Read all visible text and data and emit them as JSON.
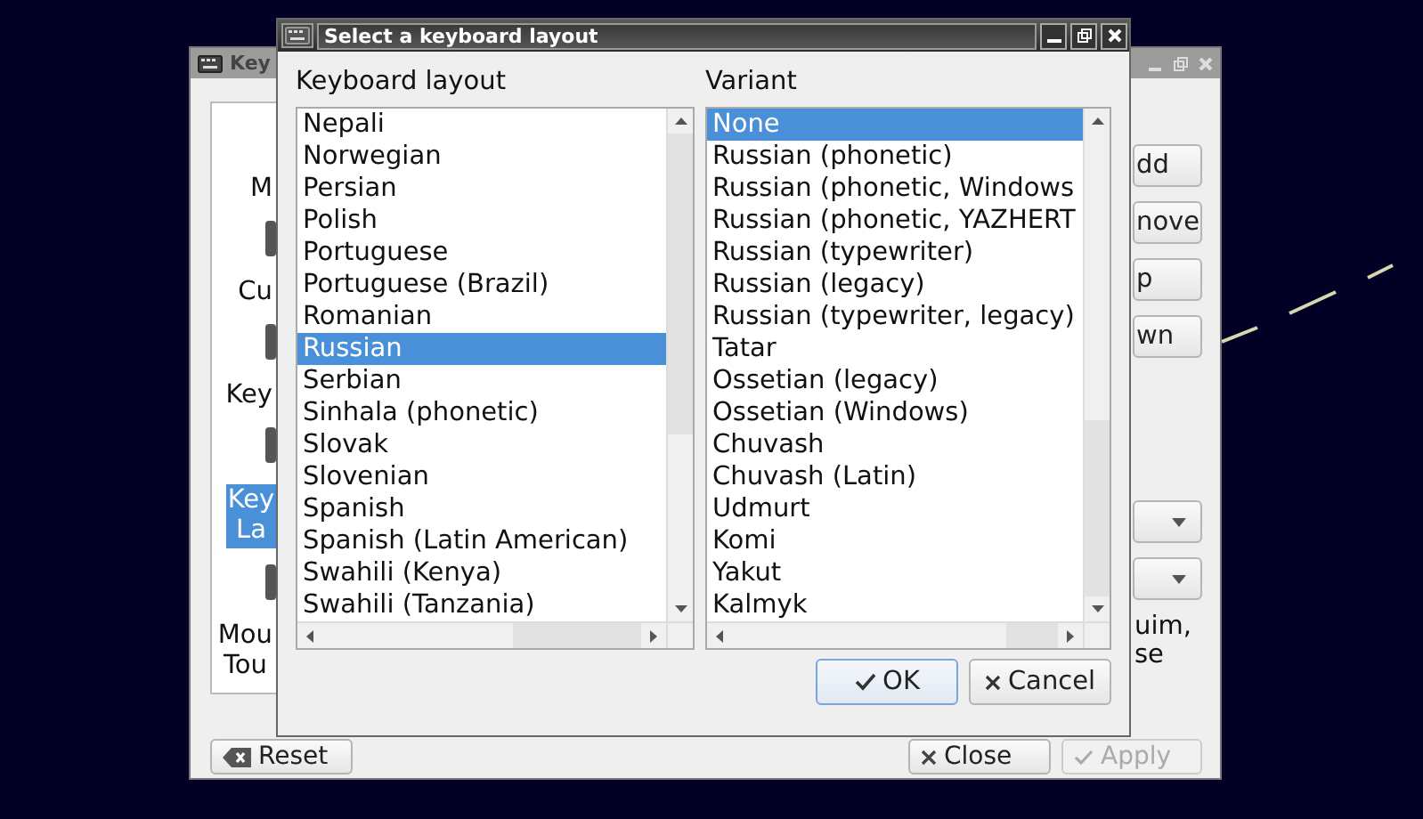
{
  "background_window": {
    "title": "Key",
    "sidebar": [
      {
        "kind": "label",
        "lines": [
          "M"
        ],
        "selected": false
      },
      {
        "kind": "icon_label",
        "lines": [
          "Cu"
        ],
        "selected": false
      },
      {
        "kind": "icon_label",
        "lines": [
          "Key"
        ],
        "selected": false
      },
      {
        "kind": "icon_label",
        "lines": [
          "Key",
          "La"
        ],
        "selected": true
      },
      {
        "kind": "icon_label",
        "lines": [
          "Mou",
          "Tou"
        ],
        "selected": false
      }
    ],
    "side_buttons": [
      "dd",
      "nove",
      "p",
      "wn"
    ],
    "note_lines": [
      "uim,",
      "se"
    ],
    "footer_buttons": [
      {
        "kind": "reset",
        "label": "Reset",
        "disabled": false
      },
      {
        "kind": "close",
        "label": "Close",
        "disabled": false
      },
      {
        "kind": "apply",
        "label": "Apply",
        "disabled": true
      }
    ]
  },
  "dialog": {
    "title": "Select a keyboard layout",
    "layout_label": "Keyboard layout",
    "layouts": [
      {
        "label": "Nepali",
        "selected": false
      },
      {
        "label": "Norwegian",
        "selected": false
      },
      {
        "label": "Persian",
        "selected": false
      },
      {
        "label": "Polish",
        "selected": false
      },
      {
        "label": "Portuguese",
        "selected": false
      },
      {
        "label": "Portuguese (Brazil)",
        "selected": false
      },
      {
        "label": "Romanian",
        "selected": false
      },
      {
        "label": "Russian",
        "selected": true
      },
      {
        "label": "Serbian",
        "selected": false
      },
      {
        "label": "Sinhala (phonetic)",
        "selected": false
      },
      {
        "label": "Slovak",
        "selected": false
      },
      {
        "label": "Slovenian",
        "selected": false
      },
      {
        "label": "Spanish",
        "selected": false
      },
      {
        "label": "Spanish (Latin American)",
        "selected": false
      },
      {
        "label": "Swahili (Kenya)",
        "selected": false
      },
      {
        "label": "Swahili (Tanzania)",
        "selected": false
      }
    ],
    "variant_label": "Variant",
    "variants": [
      {
        "label": "None",
        "selected": true
      },
      {
        "label": "Russian (phonetic)",
        "selected": false
      },
      {
        "label": "Russian (phonetic, Windows",
        "selected": false
      },
      {
        "label": "Russian (phonetic, YAZHERT",
        "selected": false
      },
      {
        "label": "Russian (typewriter)",
        "selected": false
      },
      {
        "label": "Russian (legacy)",
        "selected": false
      },
      {
        "label": "Russian (typewriter, legacy)",
        "selected": false
      },
      {
        "label": "Tatar",
        "selected": false
      },
      {
        "label": "Ossetian (legacy)",
        "selected": false
      },
      {
        "label": "Ossetian (Windows)",
        "selected": false
      },
      {
        "label": "Chuvash",
        "selected": false
      },
      {
        "label": "Chuvash (Latin)",
        "selected": false
      },
      {
        "label": "Udmurt",
        "selected": false
      },
      {
        "label": "Komi",
        "selected": false
      },
      {
        "label": "Yakut",
        "selected": false
      },
      {
        "label": "Kalmyk",
        "selected": false
      }
    ],
    "buttons": [
      {
        "kind": "ok",
        "label": "OK",
        "focused": true
      },
      {
        "kind": "cancel",
        "label": "Cancel",
        "focused": false
      }
    ]
  }
}
